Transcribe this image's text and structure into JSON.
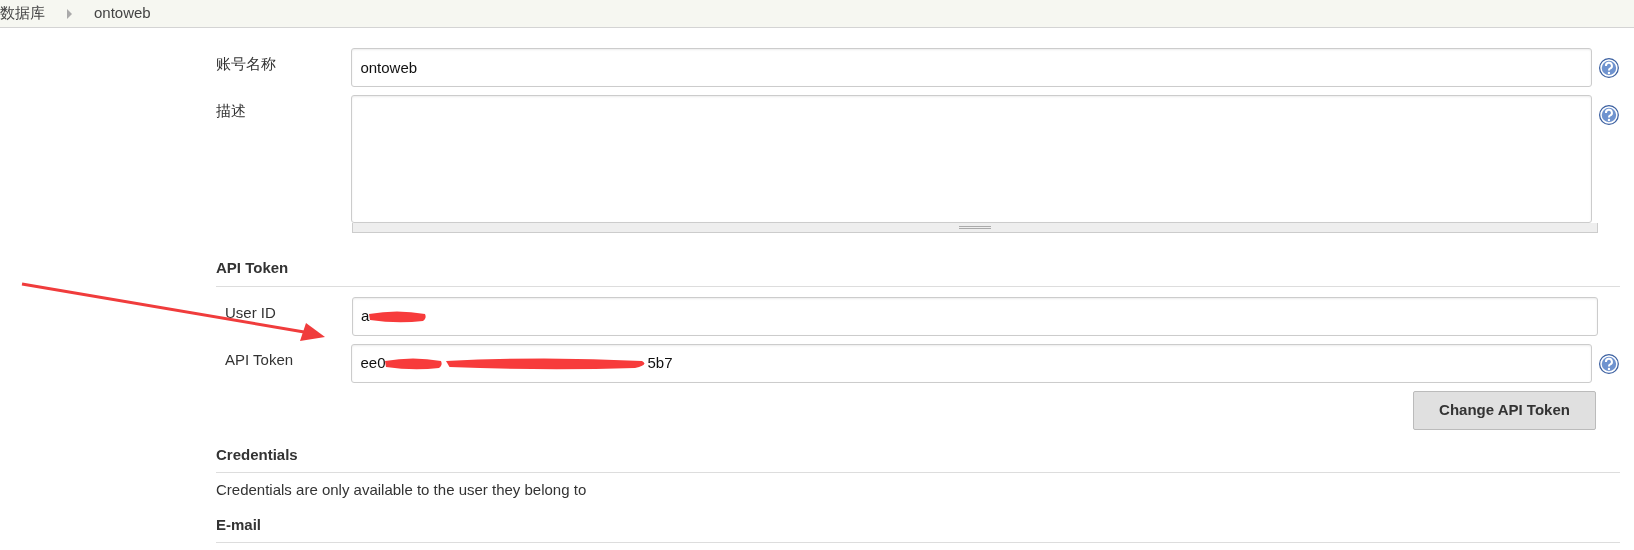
{
  "breadcrumb": [
    {
      "label": "数据库"
    },
    {
      "label": "ontoweb"
    }
  ],
  "fields": [
    {
      "label": "账号名称",
      "kind": "input",
      "value": "ontoweb",
      "help": true
    },
    {
      "label": "描述",
      "kind": "textarea",
      "help": true
    }
  ],
  "sections": [
    {
      "title": "API Token",
      "fields": [
        {
          "label": "User ID",
          "kind": "redacted",
          "value_start": "a",
          "help": false
        },
        {
          "label": "API Token",
          "kind": "redacted",
          "value_start": "ee0",
          "value_end": "5b7",
          "help": true
        }
      ],
      "button": "Change API Token"
    },
    {
      "title": "Credentials",
      "text": "Credentials are only available to the user they belong to"
    },
    {
      "title": "E-mail"
    }
  ]
}
